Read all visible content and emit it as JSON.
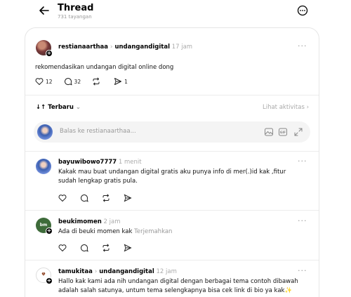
{
  "header": {
    "title": "Thread",
    "views": "731 tayangan"
  },
  "original_post": {
    "username": "restianaarthaa",
    "reply_to": "undangandigital",
    "time": "17 jam",
    "text": "rekomendasikan undangan digital online dong",
    "likes": "12",
    "comments": "32",
    "shares": "1"
  },
  "sort": {
    "label": "Terbaru",
    "activity_link": "Lihat aktivitas"
  },
  "reply_box": {
    "placeholder": "Balas ke restianaarthaa..."
  },
  "replies": [
    {
      "username": "bayuwibowo7777",
      "time": "1 menit",
      "text": "Kakak mau buat undangan digital gratis aku punya info di mer(.)id kak ,fitur sudah lengkap gratis pula."
    },
    {
      "username": "beukimomen",
      "time": "2 jam",
      "text": "Ada di beuki momen kak",
      "translate": "Terjemahkan"
    },
    {
      "username": "tamukitaa",
      "reply_to": "undangandigital",
      "time": "12 jam",
      "text": "Hallo kak kami ada nih undangan digital dengan berbagai tema contoh dibawah adalah salah satunya, untum tema selengkapnya bisa cek link di bio ya kak",
      "emoji": "✨"
    }
  ],
  "colors": {
    "muted": "#999999",
    "border": "#e6e6e6",
    "reply_box_bg": "#f4f4f4"
  }
}
